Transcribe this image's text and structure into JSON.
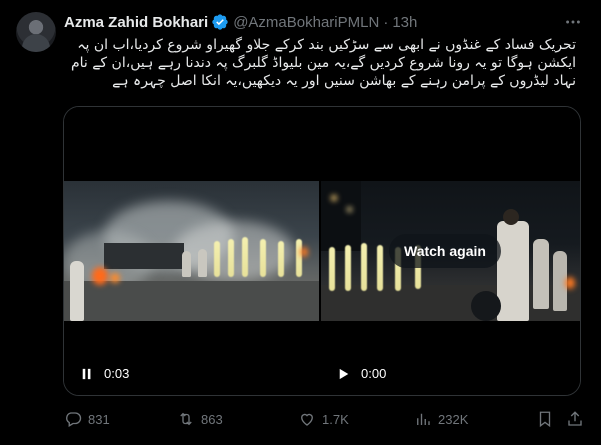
{
  "tweet": {
    "author_name": "Azma Zahid Bokhari",
    "handle": "@AzmaBokhariPMLN",
    "separator": "·",
    "time": "13h",
    "text": "تحریک فساد کے غنڈوں نے ابھی سے سڑکیں بند کرکے جلاو گھیراو شروع کردیا،اب ان پہ ایکشن ہوگا تو یہ رونا شروع کردیں گے،یہ مین بلیواڈ گلبرگ پہ دندنا رہے ہیں،ان کے نام نہاد لیڈروں کے پرامن رہنے کے بھاشن سنیں اور یہ دیکھیں،یہ انکا اصل چہرہ ہے"
  },
  "media": {
    "left_video": {
      "state_icon": "pause-icon",
      "timestamp": "0:03"
    },
    "right_video": {
      "state_icon": "play-icon",
      "timestamp": "0:00",
      "overlay_label": "Watch again"
    }
  },
  "actions": {
    "replies": "831",
    "reposts": "863",
    "likes": "1.7K",
    "views": "232K"
  },
  "colors": {
    "background": "#000000",
    "text": "#e7e9ea",
    "secondary": "#71767b",
    "verified": "#1d9bf0",
    "border": "#2f3336"
  }
}
